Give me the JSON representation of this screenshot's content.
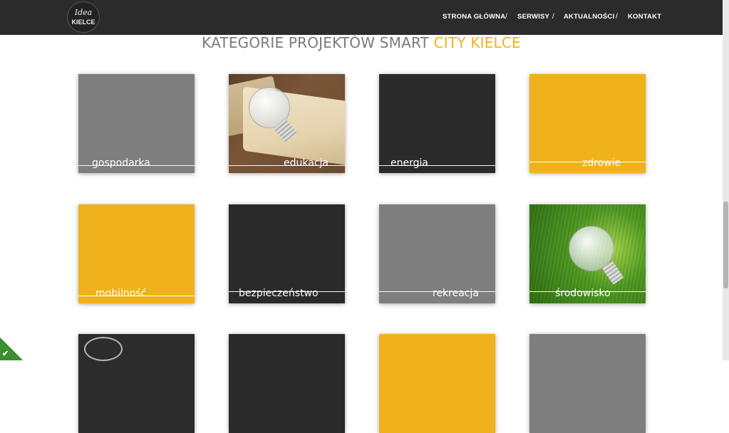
{
  "header": {
    "logo": {
      "line1": "Idea",
      "line2": "KIELCE"
    },
    "nav": [
      {
        "label": "STRONA GŁÓWNA"
      },
      {
        "label": "SERWISY"
      },
      {
        "label": "AKTUALNOŚCI"
      },
      {
        "label": "KONTAKT"
      }
    ],
    "separator": "/"
  },
  "heading": {
    "text": "KATEGORIE PROJEKTÓW SMART",
    "accent": "CITY KIELCE",
    "color": "#7a7a7a",
    "accent_color": "#f0b219"
  },
  "categories": [
    {
      "label": "gospodarka",
      "style": "grey"
    },
    {
      "label": "edukacja",
      "style": "photo-book-bulb"
    },
    {
      "label": "energia",
      "style": "dark"
    },
    {
      "label": "zdrowie",
      "style": "yellow"
    },
    {
      "label": "mobilność",
      "style": "yellow"
    },
    {
      "label": "bezpieczeństwo",
      "style": "dark"
    },
    {
      "label": "rekreacja",
      "style": "grey"
    },
    {
      "label": "środowisko",
      "style": "photo-grass-bulb"
    }
  ],
  "colors": {
    "topbar": "#2b2b2b",
    "grey": "#7f7e7f",
    "dark": "#2a2a2a",
    "yellow": "#f0b21a",
    "badge": "#3a8f2e"
  },
  "badge": {
    "icon": "checkmark-icon",
    "glyph": "✔"
  }
}
